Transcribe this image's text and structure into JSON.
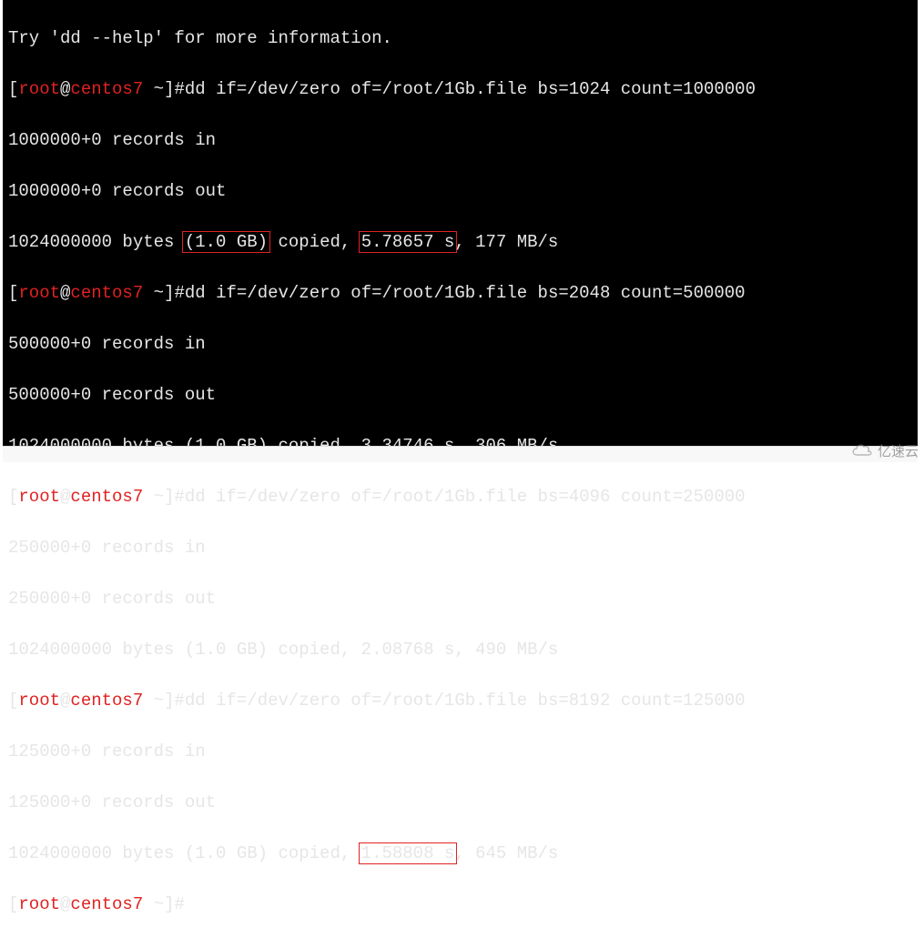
{
  "prompt": {
    "lbracket": "[",
    "user": "root",
    "at": "@",
    "host": "centos7",
    "space": " ",
    "tilde": "~",
    "rbracket": "]",
    "hash": "#"
  },
  "lines": {
    "l0": "Try 'dd --help' for more information.",
    "cmd1": "dd if=/dev/zero of=/root/1Gb.file bs=1024 count=1000000",
    "r1a": "1000000+0 records in",
    "r1b": "1000000+0 records out",
    "r1c_pre": "1024000000 bytes ",
    "r1c_hl1": "(1.0 GB)",
    "r1c_mid": " copied, ",
    "r1c_hl2": "5.78657 s",
    "r1c_post": ", 177 MB/s",
    "cmd2": "dd if=/dev/zero of=/root/1Gb.file bs=2048 count=500000",
    "r2a": "500000+0 records in",
    "r2b": "500000+0 records out",
    "r2c": "1024000000 bytes (1.0 GB) copied, 3.34746 s, 306 MB/s",
    "cmd3": "dd if=/dev/zero of=/root/1Gb.file bs=4096 count=250000",
    "r3a": "250000+0 records in",
    "r3b": "250000+0 records out",
    "r3c": "1024000000 bytes (1.0 GB) copied, 2.08768 s, 490 MB/s",
    "cmd4": "dd if=/dev/zero of=/root/1Gb.file bs=8192 count=125000",
    "r4a": "125000+0 records in",
    "r4b": "125000+0 records out",
    "r4c_pre": "1024000000 bytes (1.0 GB) copied, ",
    "r4c_hl": "1.58808 s",
    "r4c_post": ", 645 MB/s"
  },
  "watermark": {
    "text": "亿速云"
  },
  "taskbar": {
    "left": "",
    "right": ""
  }
}
